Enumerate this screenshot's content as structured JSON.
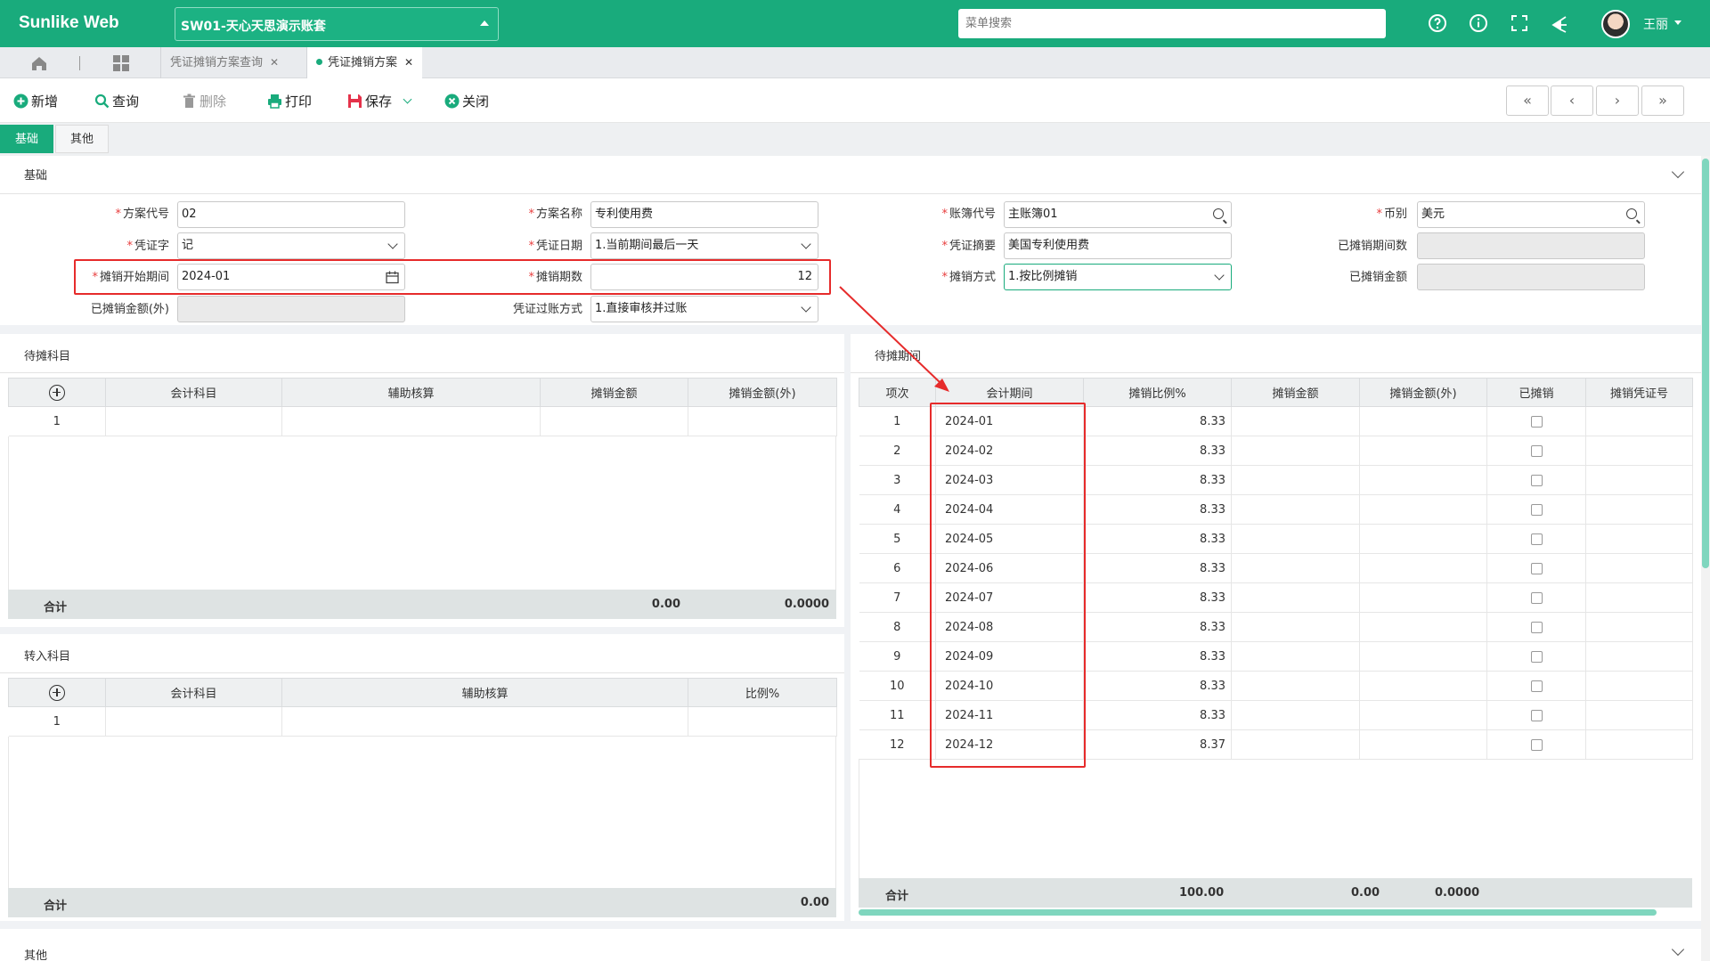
{
  "app": {
    "brand": "Sunlike Web",
    "account": "SW01-天心天思演示账套",
    "menu_search_placeholder": "菜单搜索",
    "user": "王丽"
  },
  "tabs": [
    {
      "label": "凭证摊销方案查询",
      "active": false
    },
    {
      "label": "凭证摊销方案",
      "active": true
    }
  ],
  "toolbar": {
    "add": "新增",
    "query": "查询",
    "delete": "删除",
    "print": "打印",
    "save": "保存",
    "close": "关闭"
  },
  "form_tabs": [
    "基础",
    "其他"
  ],
  "sections": {
    "basic": "基础",
    "pending_accounts": "待摊科目",
    "pending_periods": "待摊期间",
    "transfer_accounts": "转入科目",
    "other": "其他"
  },
  "form": {
    "scheme_code": {
      "label": "方案代号",
      "value": "02"
    },
    "scheme_name": {
      "label": "方案名称",
      "value": "专利使用费"
    },
    "ledger_code": {
      "label": "账簿代号",
      "value": "主账簿01"
    },
    "currency": {
      "label": "币别",
      "value": "美元"
    },
    "voucher_word": {
      "label": "凭证字",
      "value": "记"
    },
    "voucher_date": {
      "label": "凭证日期",
      "value": "1.当前期间最后一天"
    },
    "voucher_summary": {
      "label": "凭证摘要",
      "value": "美国专利使用费"
    },
    "amortized_periods": {
      "label": "已摊销期间数",
      "value": ""
    },
    "start_period": {
      "label": "摊销开始期间",
      "value": "2024-01"
    },
    "period_count": {
      "label": "摊销期数",
      "value": "12"
    },
    "amort_method": {
      "label": "摊销方式",
      "value": "1.按比例摊销"
    },
    "amortized_amount": {
      "label": "已摊销金额",
      "value": ""
    },
    "amortized_amount_fx": {
      "label": "已摊销金额(外)",
      "value": ""
    },
    "posting_method": {
      "label": "凭证过账方式",
      "value": "1.直接审核并过账"
    }
  },
  "pending_table": {
    "headers": [
      "会计科目",
      "辅助核算",
      "摊销金额",
      "摊销金额(外)"
    ],
    "rows": [
      {
        "no": "1"
      }
    ],
    "footer": {
      "label": "合计",
      "amount": "0.00",
      "amount_fx": "0.0000"
    }
  },
  "transfer_table": {
    "headers": [
      "会计科目",
      "辅助核算",
      "比例%"
    ],
    "rows": [
      {
        "no": "1"
      }
    ],
    "footer": {
      "label": "合计",
      "ratio": "0.00"
    }
  },
  "periods_table": {
    "headers": [
      "项次",
      "会计期间",
      "摊销比例%",
      "摊销金额",
      "摊销金额(外)",
      "已摊销",
      "摊销凭证号"
    ],
    "rows": [
      {
        "no": "1",
        "period": "2024-01",
        "ratio": "8.33"
      },
      {
        "no": "2",
        "period": "2024-02",
        "ratio": "8.33"
      },
      {
        "no": "3",
        "period": "2024-03",
        "ratio": "8.33"
      },
      {
        "no": "4",
        "period": "2024-04",
        "ratio": "8.33"
      },
      {
        "no": "5",
        "period": "2024-05",
        "ratio": "8.33"
      },
      {
        "no": "6",
        "period": "2024-06",
        "ratio": "8.33"
      },
      {
        "no": "7",
        "period": "2024-07",
        "ratio": "8.33"
      },
      {
        "no": "8",
        "period": "2024-08",
        "ratio": "8.33"
      },
      {
        "no": "9",
        "period": "2024-09",
        "ratio": "8.33"
      },
      {
        "no": "10",
        "period": "2024-10",
        "ratio": "8.33"
      },
      {
        "no": "11",
        "period": "2024-11",
        "ratio": "8.33"
      },
      {
        "no": "12",
        "period": "2024-12",
        "ratio": "8.37"
      }
    ],
    "footer": {
      "label": "合计",
      "ratio": "100.00",
      "amount": "0.00",
      "amount_fx": "0.0000"
    }
  },
  "colors": {
    "brand": "#19ab7c",
    "highlight": "#e62b2b"
  }
}
